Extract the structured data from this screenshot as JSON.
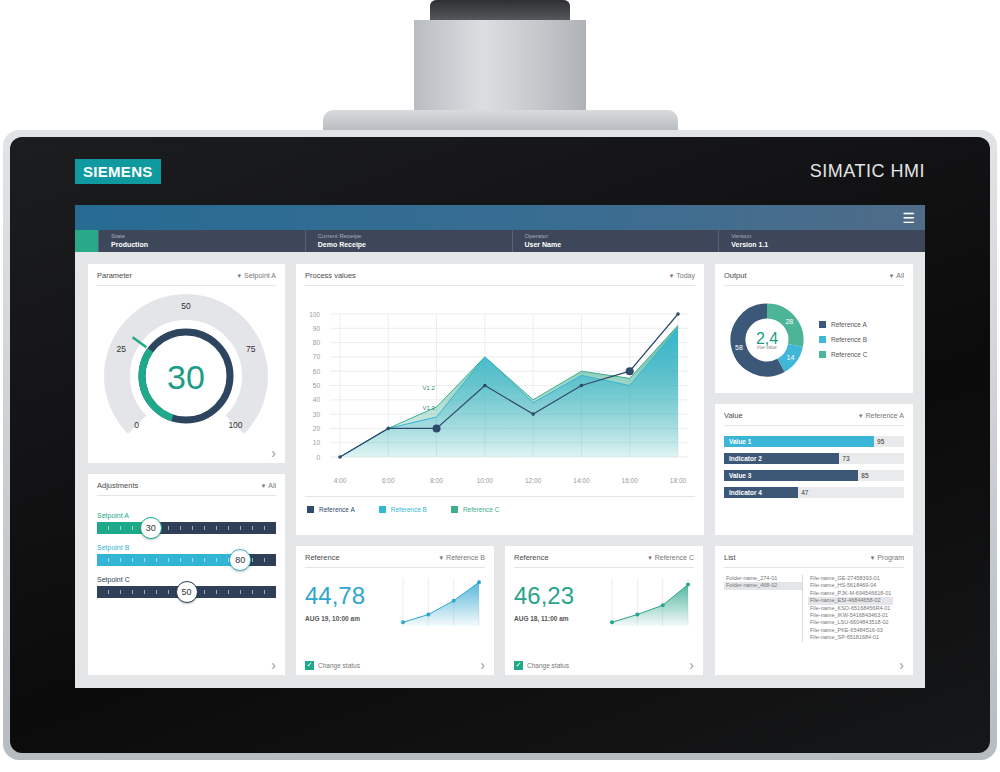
{
  "device": {
    "brand": "SIEMENS",
    "model": "SIMATIC HMI"
  },
  "icons": {
    "menu": "☰",
    "dropdown": "▾",
    "more": "›",
    "check": "✓"
  },
  "status_strip": {
    "state_color": "#2aa88a",
    "fields": [
      {
        "label": "State",
        "value": "Production"
      },
      {
        "label": "Current Receipe",
        "value": "Demo Receipe"
      },
      {
        "label": "Operator",
        "value": "User Name"
      },
      {
        "label": "Version",
        "value": "Version 1.1"
      }
    ]
  },
  "parameter": {
    "title": "Parameter",
    "filter": "Setpoint A",
    "value": "30",
    "level": 0.3,
    "ticks": [
      "0",
      "25",
      "50",
      "75",
      "100"
    ],
    "more": true
  },
  "adjustments": {
    "title": "Adjustments",
    "filter": "All",
    "more": true,
    "sliders": [
      {
        "label": "Setpoint A",
        "value": "30",
        "level": 0.3,
        "color": "#1ea98a"
      },
      {
        "label": "Setpoint B",
        "value": "80",
        "level": 0.8,
        "color": "#33b5d5"
      },
      {
        "label": "Setpoint C",
        "value": "50",
        "level": 0.5,
        "color": "#2e3f57"
      }
    ]
  },
  "process": {
    "title": "Process values",
    "filter": "Today",
    "more": false,
    "y_ticks": [
      "0",
      "10",
      "20",
      "30",
      "40",
      "50",
      "60",
      "70",
      "80",
      "90",
      "100"
    ],
    "x_labels": [
      "4:00",
      "6:00",
      "8:00",
      "10:00",
      "12:00",
      "14:00",
      "16:00",
      "18:00"
    ],
    "series": [
      {
        "name": "Reference A",
        "kind": "line",
        "color": "#2f4a6b",
        "values": [
          0,
          20,
          20,
          50,
          30,
          50,
          60,
          100
        ]
      },
      {
        "name": "Reference B",
        "kind": "area",
        "color": "#33b5d5",
        "values": [
          0,
          20,
          28,
          70,
          38,
          57,
          50,
          90
        ]
      },
      {
        "name": "Reference C",
        "kind": "area",
        "color": "#3fae8f",
        "values": [
          0,
          20,
          35,
          70,
          40,
          60,
          55,
          92
        ]
      }
    ],
    "highlight_points": [
      2,
      6
    ],
    "annotations": [
      {
        "text": "V1.2",
        "index": 2,
        "value": 48
      },
      {
        "text": "V1.3",
        "index": 2,
        "value": 34
      }
    ]
  },
  "output": {
    "title": "Output",
    "filter": "All",
    "more": false,
    "center": "2,4",
    "center_caption": "true value",
    "segments": [
      {
        "name": "Reference A",
        "value": 58,
        "label": "58",
        "color": "#3c5878"
      },
      {
        "name": "Reference B",
        "value": 14,
        "label": "14",
        "color": "#41b7d7"
      },
      {
        "name": "Reference C",
        "value": 28,
        "label": "28",
        "color": "#4db597"
      }
    ]
  },
  "value_card": {
    "title": "Value",
    "filter": "Reference A",
    "more": false,
    "bars": [
      {
        "label": "Value 1",
        "value": "95",
        "level": 0.95,
        "color": "#3cb6d6"
      },
      {
        "label": "Indicator 2",
        "value": "73",
        "level": 0.73,
        "color": "#3d5877"
      },
      {
        "label": "Value 3",
        "value": "85",
        "level": 0.85,
        "color": "#3d5877"
      },
      {
        "label": "Indicator 4",
        "value": "47",
        "level": 0.47,
        "color": "#3d5877"
      }
    ]
  },
  "references": [
    {
      "title": "Reference",
      "filter": "Reference B",
      "value": "44,78",
      "date": "AUG 19, 10:00 am",
      "color": "#2fa6cf",
      "values": [
        8,
        25,
        55,
        95
      ],
      "checkbox": {
        "label": "Change status",
        "checked": true
      },
      "more": true
    },
    {
      "title": "Reference",
      "filter": "Reference C",
      "value": "46,23",
      "date": "AUG 18, 11:00 am",
      "color": "#2aa48a",
      "values": [
        8,
        25,
        45,
        90
      ],
      "checkbox": {
        "label": "Change status",
        "checked": true
      },
      "more": true
    }
  ],
  "list": {
    "title": "List",
    "filter": "Program",
    "more": true,
    "folders": [
      {
        "name": "Folder-name_274-01",
        "selected": false
      },
      {
        "name": "Folder-name_468-02",
        "selected": true
      }
    ],
    "files": [
      {
        "name": "File-name_GE-27458393-01",
        "selected": false
      },
      {
        "name": "File-name_HS-5618469-04",
        "selected": false
      },
      {
        "name": "File-name_PJK-M-694546618-01",
        "selected": false
      },
      {
        "name": "File-name_ESI-46844658-02",
        "selected": true
      },
      {
        "name": "File-name_KSO-65168456R4-01",
        "selected": false
      },
      {
        "name": "File-name_IKW-5416843463-01",
        "selected": false
      },
      {
        "name": "File-name_LSU-6604843518-02",
        "selected": false
      },
      {
        "name": "File-name_PKE-65484516-03",
        "selected": false
      },
      {
        "name": "File-name_SP-65181684-01",
        "selected": false
      }
    ]
  }
}
